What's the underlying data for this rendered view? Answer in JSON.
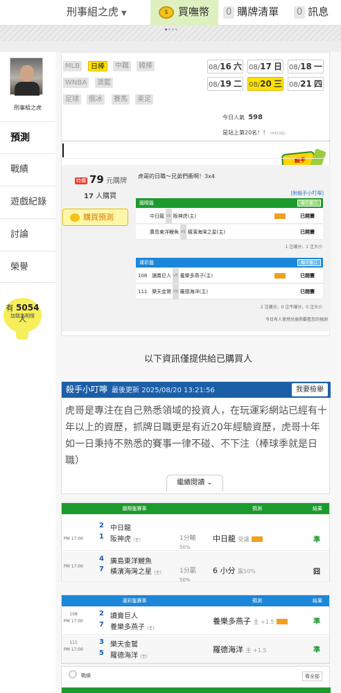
{
  "topbar": {
    "username": "刑事組之虎",
    "buy_coin": "買嘸幣",
    "purchase_count": "0",
    "purchase_list": "購牌清單",
    "message_count": "0",
    "messages": "訊息"
  },
  "sidebar": {
    "username": "刑事組之虎",
    "items": [
      {
        "label": "預測"
      },
      {
        "label": "戰績"
      },
      {
        "label": "遊戲紀錄"
      },
      {
        "label": "討論"
      },
      {
        "label": "榮譽"
      }
    ],
    "fans_prefix": "有",
    "fans_count": "5054",
    "fans_suffix": "人",
    "fans_text": "加我為明燈"
  },
  "leagues": [
    "MLB",
    "日棒",
    "中職",
    "韓棒",
    "WNBA",
    "澳籃",
    "足球",
    "俄冰",
    "賽馬",
    "美足"
  ],
  "active_league": "日棒",
  "dates": [
    {
      "md": "08/",
      "d": "16",
      "w": "六"
    },
    {
      "md": "08/",
      "d": "17",
      "w": "日"
    },
    {
      "md": "08/",
      "d": "18",
      "w": "一"
    },
    {
      "md": "08/",
      "d": "19",
      "w": "二"
    },
    {
      "md": "08/",
      "d": "20",
      "w": "三"
    },
    {
      "md": "08/",
      "d": "21",
      "w": "四"
    }
  ],
  "popularity_label": "今日人氣",
  "popularity_value": "598",
  "rank_text": "是站上第20名！！",
  "rank_sub": "(Hit53名)",
  "badge_text": "殺手",
  "prediction": {
    "special_tag": "特價",
    "price": "79",
    "price_unit": "元購牌",
    "buyers_count": "17",
    "buyers_label": "人購買",
    "buy_button": "購買預測",
    "description": "虎哥的日職～兄弟們衝啊！3x4",
    "tips_link": "[附殺手小叮嚀]",
    "intl_header": "國際盤",
    "show_button": "顯示盤口",
    "intl_rows": [
      {
        "home": "中日龍",
        "away": "阪神虎(主)",
        "status": "已開賽"
      },
      {
        "home": "廣島東洋鯉魚",
        "away": "橫濱海灣之星(主)",
        "status": "已開賽"
      }
    ],
    "intl_note": "1 注讓分，1 注大小",
    "lottery_header": "運彩盤",
    "lottery_rows": [
      {
        "no": "108",
        "home": "讀賣巨人",
        "away": "養樂多燕子(主)",
        "status": "已開賽"
      },
      {
        "no": "111",
        "home": "樂天金鷲",
        "away": "羅德海洋(主)",
        "status": "已開賽"
      }
    ],
    "lottery_note": "2 注讓分，0 注不讓分，0 注大小",
    "exchange_note": "今日有人使用兌換券觀看您的預測"
  },
  "info_text": "以下資訊僅提供給已購買人",
  "tips": {
    "title": "殺手小叮嚀",
    "updated": "最後更新 2025/08/20 13:21:56",
    "report_button": "我要檢舉",
    "body": "虎哥是專注在自己熟悉領域的投資人，在玩運彩網站已經有十年以上的資歷，抓牌日職更是有近20年經驗資歷，虎哥十年如一日秉持不熟悉的賽事一律不碰、不下注（棒球季就是日職）",
    "more_button": "繼續閱讀"
  },
  "intl_table": {
    "headers": [
      "國際盤賽事",
      "預測",
      "結果"
    ],
    "rows": [
      {
        "time": "PM 17:00",
        "n1": "2",
        "t1": "中日龍",
        "n2": "1",
        "t2": "阪神虎",
        "host": "(主)",
        "line": "1分輸",
        "line2": "50%",
        "pred": "中日龍",
        "pred_note": "受讓",
        "result": "準",
        "color": "#1c9a2e"
      },
      {
        "time": "PM 17:00",
        "n1": "4",
        "t1": "廣島東洋鯉魚",
        "n2": "7",
        "t2": "橫濱海灣之星",
        "host": "(主)",
        "line": "1分贏",
        "line2": "50%",
        "pred": "6 小分",
        "pred_note": "贏50%",
        "result": "囧",
        "color": "#333333"
      }
    ]
  },
  "lottery_table": {
    "headers": [
      "運彩盤賽事",
      "預測",
      "結果"
    ],
    "rows": [
      {
        "no": "108",
        "time": "PM 17:00",
        "n1": "2",
        "t1": "讀賣巨人",
        "n2": "7",
        "t2": "養樂多燕子",
        "host": "(主)",
        "pred": "養樂多燕子",
        "pred_note": "主 +1.5",
        "result": "準",
        "color": "#1c9a2e"
      },
      {
        "no": "111",
        "time": "PM 17:00",
        "n1": "3",
        "t1": "樂天金鷲",
        "n2": "5",
        "t2": "羅德海洋",
        "host": "(主)",
        "pred": "羅德海洋",
        "pred_note": "主 +1.5",
        "result": "準",
        "color": "#1c9a2e"
      }
    ]
  },
  "record": {
    "title": "戰績",
    "all_button": "看全部"
  }
}
